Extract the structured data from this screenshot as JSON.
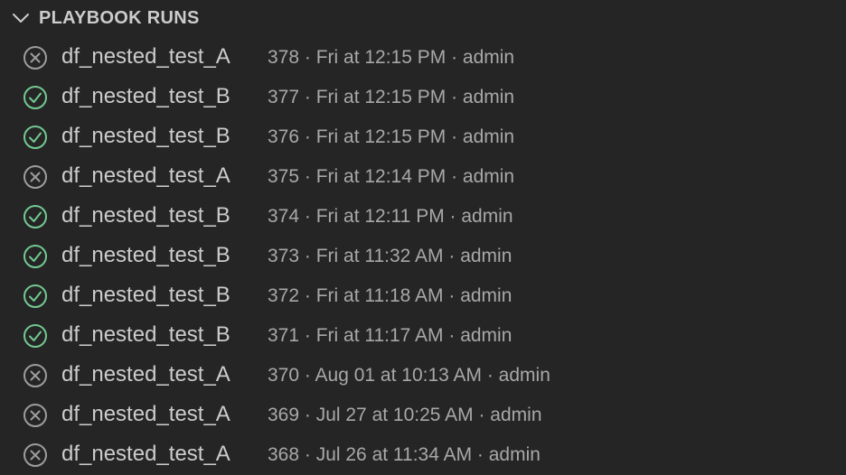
{
  "header": {
    "title": "PLAYBOOK RUNS",
    "expand_icon": "chevron-down-icon"
  },
  "colors": {
    "background": "#252526",
    "text": "#cccccc",
    "description": "#a8a8a8",
    "success": "#73c991",
    "failed": "#9d9d9d"
  },
  "runs": [
    {
      "status": "failed",
      "icon": "circle-x-icon",
      "name": "df_nested_test_A",
      "description": "378 · Fri at 12:15 PM · admin"
    },
    {
      "status": "success",
      "icon": "circle-check-icon",
      "name": "df_nested_test_B",
      "description": "377 · Fri at 12:15 PM · admin"
    },
    {
      "status": "success",
      "icon": "circle-check-icon",
      "name": "df_nested_test_B",
      "description": "376 · Fri at 12:15 PM · admin"
    },
    {
      "status": "failed",
      "icon": "circle-x-icon",
      "name": "df_nested_test_A",
      "description": "375 · Fri at 12:14 PM · admin"
    },
    {
      "status": "success",
      "icon": "circle-check-icon",
      "name": "df_nested_test_B",
      "description": "374 · Fri at 12:11 PM · admin"
    },
    {
      "status": "success",
      "icon": "circle-check-icon",
      "name": "df_nested_test_B",
      "description": "373 · Fri at 11:32 AM · admin"
    },
    {
      "status": "success",
      "icon": "circle-check-icon",
      "name": "df_nested_test_B",
      "description": "372 · Fri at 11:18 AM · admin"
    },
    {
      "status": "success",
      "icon": "circle-check-icon",
      "name": "df_nested_test_B",
      "description": "371 · Fri at 11:17 AM · admin"
    },
    {
      "status": "failed",
      "icon": "circle-x-icon",
      "name": "df_nested_test_A",
      "description": "370 · Aug 01 at 10:13 AM · admin"
    },
    {
      "status": "failed",
      "icon": "circle-x-icon",
      "name": "df_nested_test_A",
      "description": "369 · Jul 27 at 10:25 AM · admin"
    },
    {
      "status": "failed",
      "icon": "circle-x-icon",
      "name": "df_nested_test_A",
      "description": "368 · Jul 26 at 11:34 AM · admin"
    }
  ]
}
